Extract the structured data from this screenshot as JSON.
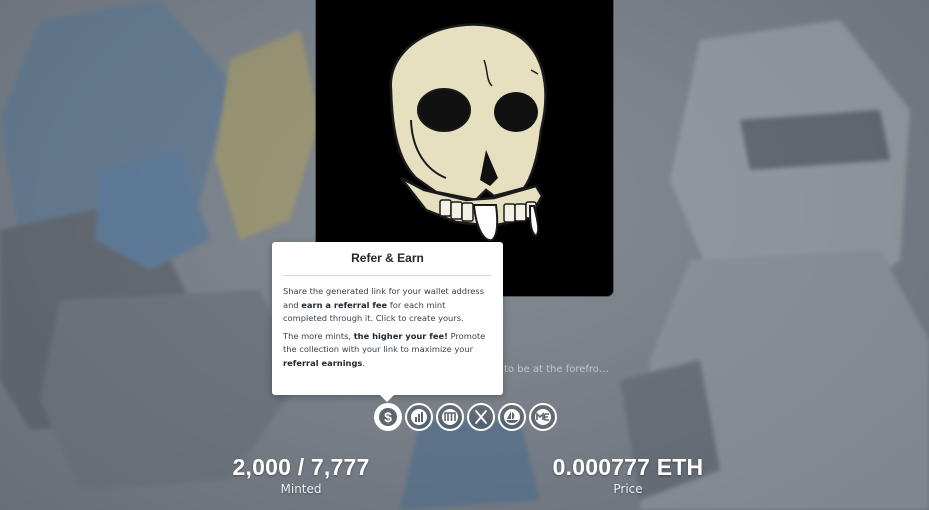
{
  "popover": {
    "title": "Refer & Earn",
    "p1_a": "Share the generated link for your wallet address and ",
    "p1_b": "earn a referral fee",
    "p1_c": " for each mint completed through it. Click to create yours.",
    "p2_a": "The more mints, ",
    "p2_b": "the higher your fee!",
    "p2_c": " Promote the collection with your link to maximize your ",
    "p2_d": "referral earnings",
    "p2_e": "."
  },
  "description_fragment": "to be at the forefro…",
  "dot_fragment": ".",
  "icons": [
    {
      "name": "dollar-icon",
      "active": true
    },
    {
      "name": "chart-icon",
      "active": false
    },
    {
      "name": "magic-eden-m-icon",
      "active": false
    },
    {
      "name": "x-icon",
      "active": false
    },
    {
      "name": "opensea-icon",
      "active": false
    },
    {
      "name": "me-icon",
      "active": false
    }
  ],
  "stats": {
    "minted_value": "2,000 / 7,777",
    "minted_label": "Minted",
    "price_value": "0.000777 ETH",
    "price_label": "Price"
  },
  "colors": {
    "background": "#6f7680",
    "card": "#000000",
    "skull": "#e6dfc0"
  }
}
